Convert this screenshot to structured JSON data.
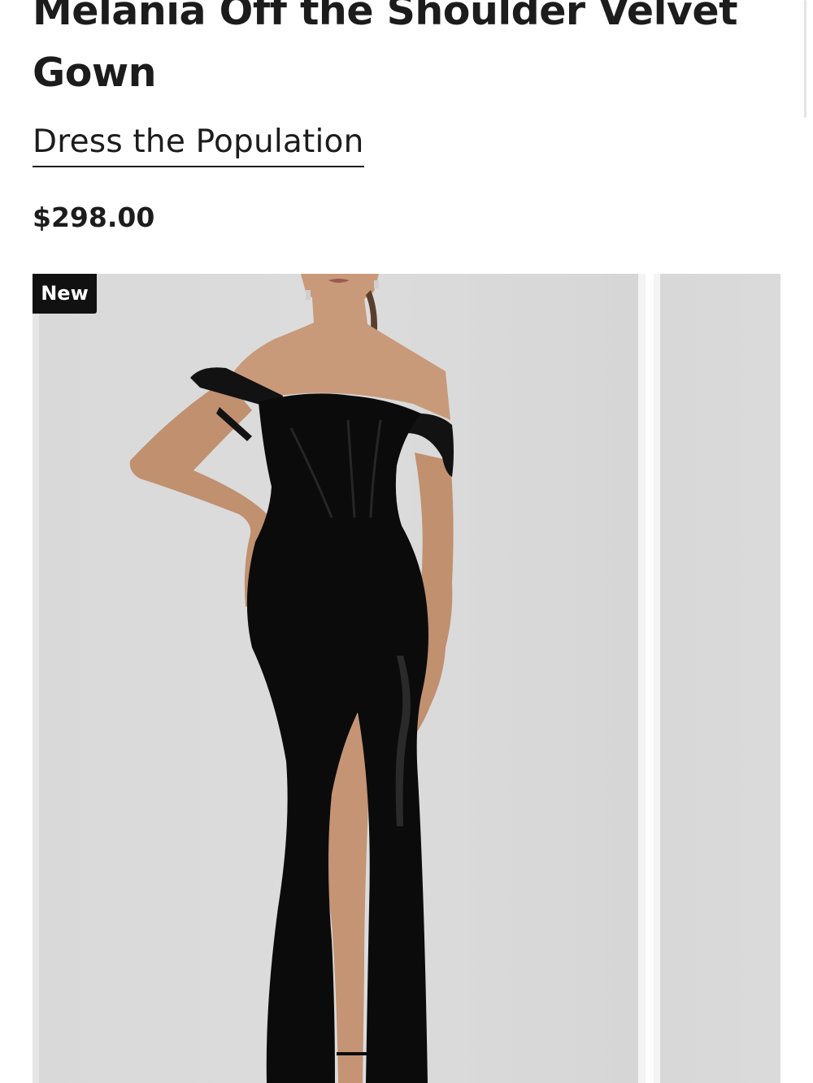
{
  "product": {
    "title": "Melania Off the Shoulder Velvet Gown",
    "brand": "Dress the Population",
    "price": "$298.00"
  },
  "gallery": {
    "badge": "New",
    "slide_count_visible": 2,
    "image_alt": "Model wearing black off the shoulder velvet gown with thigh-high slit"
  },
  "colors": {
    "text": "#1c1c1c",
    "badge_bg": "#111111",
    "badge_text": "#ffffff",
    "image_bg": "#dcdcdc",
    "gown": "#0b0b0b",
    "skin": "#c89a7a"
  }
}
